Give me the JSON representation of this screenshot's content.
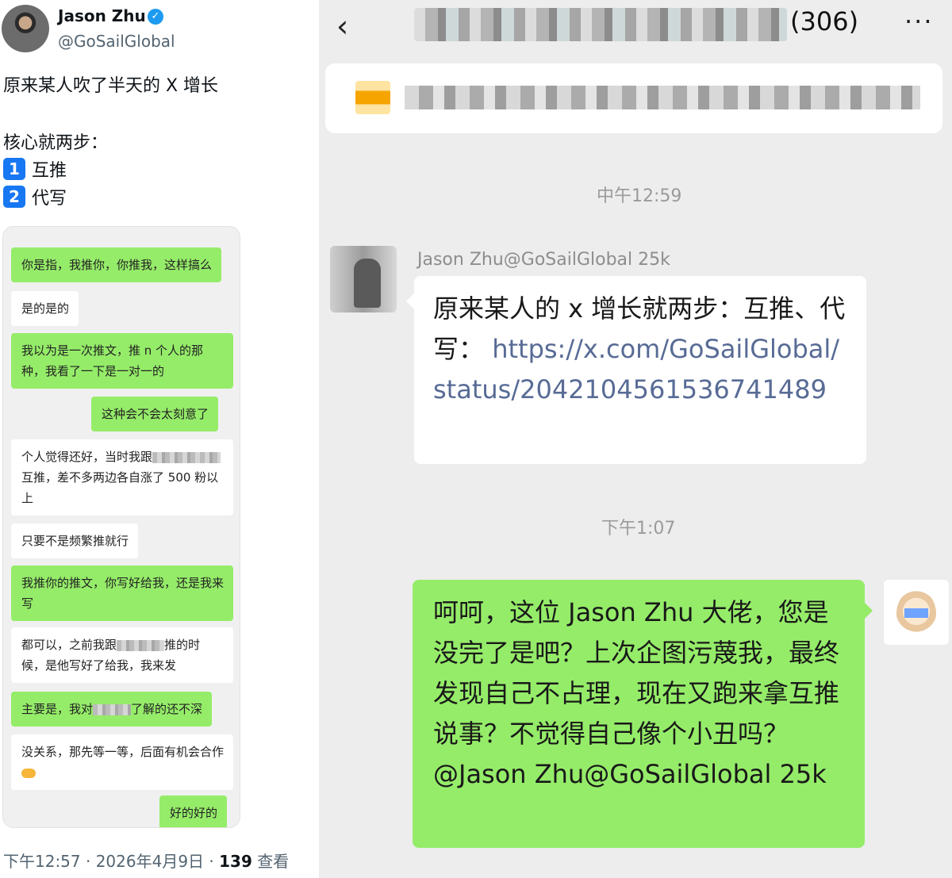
{
  "tweet": {
    "author_name": "Jason Zhu",
    "author_handle": "@GoSailGlobal",
    "text_line1": "原来某人吹了半天的 X 增长",
    "text_line2": "核心就两步：",
    "steps": [
      {
        "num": "1",
        "label": "互推"
      },
      {
        "num": "2",
        "label": "代写"
      }
    ],
    "time": "下午12:57 · 2026年4月9日 · ",
    "views": "139",
    "views_label": " 查看"
  },
  "embedded_chat": {
    "messages": [
      {
        "side": "me",
        "text": "你是指，我推你，你推我，这样搞么"
      },
      {
        "side": "other",
        "text": "是的是的"
      },
      {
        "side": "me",
        "text": "我以为是一次推文，推 n 个人的那种，我看了一下是一对一的"
      },
      {
        "side": "me",
        "text": "这种会不会太刻意了"
      },
      {
        "side": "other",
        "text_a": "个人觉得还好，当时我跟",
        "text_b": "互推，差不多两边各自涨了 500 粉以上"
      },
      {
        "side": "other",
        "text": "只要不是频繁推就行"
      },
      {
        "side": "me",
        "text": "我推你的推文，你写好给我，还是我来写"
      },
      {
        "side": "other",
        "text_a": "都可以，之前我跟",
        "text_b": "推的时候，是他写好了给我，我来发"
      },
      {
        "side": "me",
        "text_a": "主要是，我对",
        "text_b": "了解的还不深"
      },
      {
        "side": "other",
        "text": "没关系，那先等一等，后面有机会合作"
      },
      {
        "side": "me",
        "text": "好的好的"
      }
    ]
  },
  "wechat": {
    "member_count": "(306)",
    "more_icon": "···",
    "back_icon": "‹",
    "time1": "中午12:59",
    "sender": "Jason Zhu@GoSailGlobal 25k",
    "msg1_text": "原来某人的 x 增长就两步：互推、代写：",
    "msg1_link": "https://x.com/GoSailGlobal/status/2042104561536741489",
    "time2": "下午1:07",
    "msg2_text": "呵呵，这位 Jason Zhu 大佬，您是没完了是吧？上次企图污蔑我，最终发现自己不占理，现在又跑来拿互推说事？不觉得自己像个小丑吗？ @Jason Zhu@GoSailGlobal 25k"
  },
  "colors": {
    "wechat_green": "#95ec69",
    "x_blue": "#1d9bf0",
    "link_blue": "#576b95"
  }
}
